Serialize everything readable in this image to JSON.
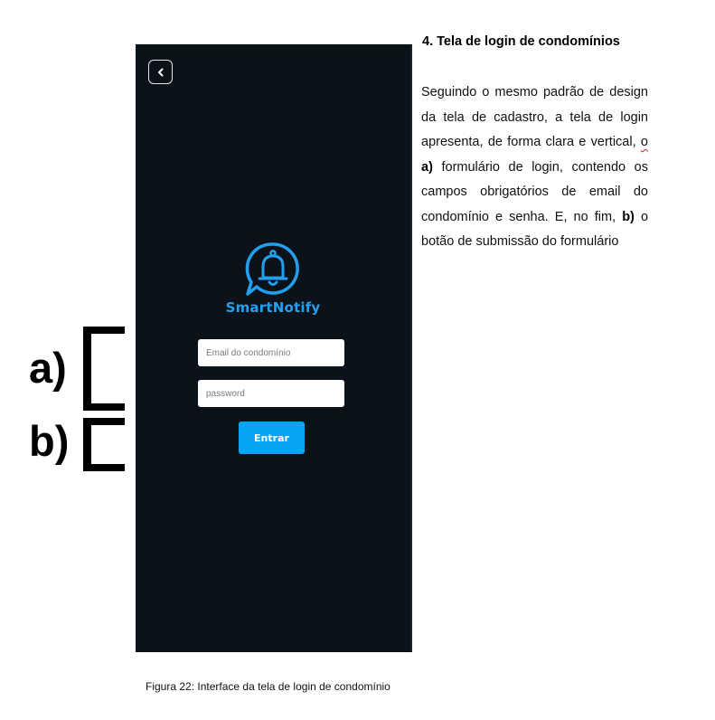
{
  "app": {
    "back_icon": "chevron-left-icon",
    "logo_icon": "bell-chat-icon",
    "brand_name": "SmartNotify",
    "email_placeholder": "Email do condomínio",
    "password_placeholder": "password",
    "submit_label": "Entrar",
    "colors": {
      "background": "#0b1219",
      "accent": "#08a4f2",
      "brand": "#22a0f0"
    }
  },
  "annotations": {
    "a_label": "a)",
    "b_label": "b)"
  },
  "document": {
    "section_title": "4. Tela de login de condomínios",
    "body_1": "Seguindo o mesmo padrão de design da tela de cadastro, a tela de login apresenta, de forma clara e vertical, ",
    "body_o": "o",
    "body_a_ref": "a)",
    "body_2": " formulário de login, contendo os campos obrigatórios de email do condomínio e senha. E, no fim, ",
    "body_b_ref": "b)",
    "body_3": " o botão de submissão do formulário",
    "caption": "Figura 22: Interface da tela de login de condomínio"
  }
}
